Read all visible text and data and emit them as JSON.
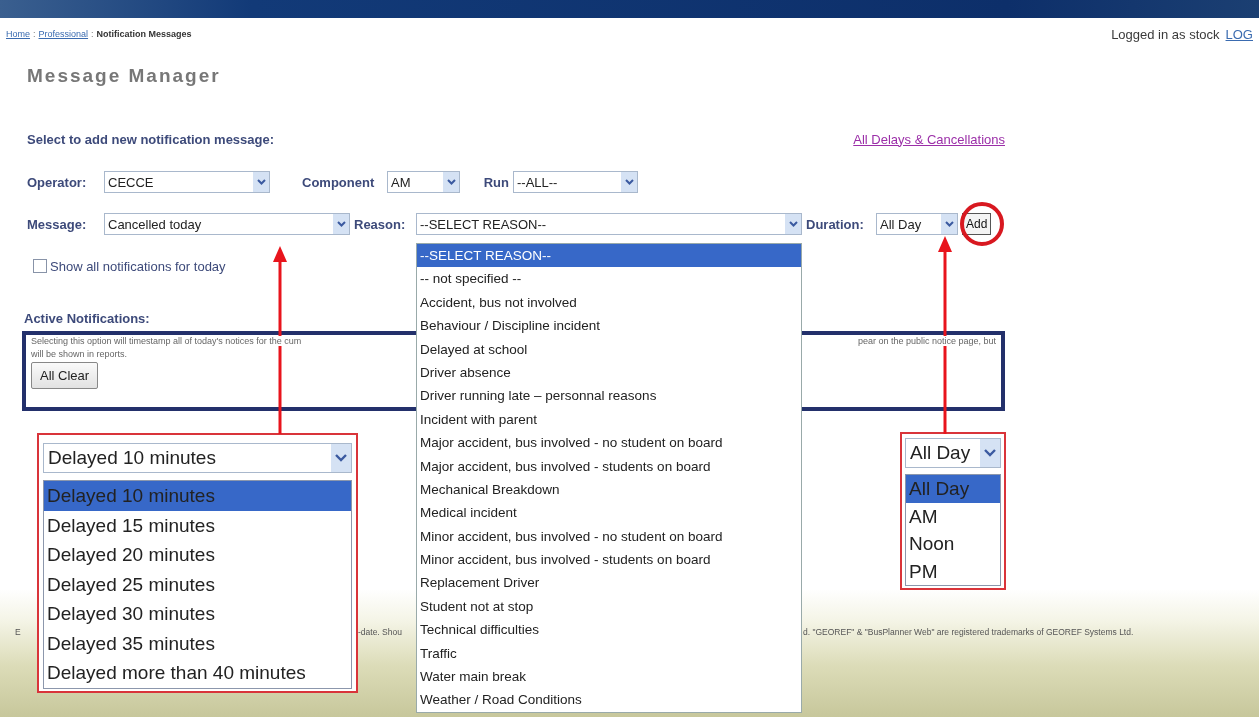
{
  "header": {
    "breadcrumb": [
      {
        "label": "Home",
        "link": true
      },
      {
        "label": "Professional",
        "link": true
      },
      {
        "label": "Notification Messages",
        "link": false
      }
    ],
    "separator": ":",
    "login_text": "Logged in as stock",
    "logout_link": "LOG"
  },
  "title": "Message Manager",
  "form": {
    "heading": "Select to add new notification message:",
    "all_link": "All Delays & Cancellations",
    "operator": {
      "label": "Operator:",
      "value": "CECCE"
    },
    "component": {
      "label": "Component",
      "value": "AM"
    },
    "run": {
      "label": "Run",
      "value": "--ALL--"
    },
    "message": {
      "label": "Message:",
      "value": "Cancelled today"
    },
    "reason": {
      "label": "Reason:",
      "value": "--SELECT REASON--"
    },
    "duration": {
      "label": "Duration:",
      "value": "All Day"
    },
    "add_button": "Add",
    "show_all": {
      "label": "Show all notifications for today",
      "checked": false
    }
  },
  "active_notifications": {
    "heading": "Active Notifications:",
    "notice_left": "Selecting this option will timestamp all of today's notices for the cum",
    "notice_right": "pear on the public notice page, but",
    "notice_line2": "will be shown in reports.",
    "button": "All Clear"
  },
  "footer": {
    "fragments": [
      "E",
      "-date. Shou",
      "d. \"GEOREF\" & \"BusPlanner Web\" are registered trademarks of GEOREF Systems Ltd."
    ]
  },
  "reason_list": [
    {
      "label": "--SELECT REASON--",
      "selected": true
    },
    {
      "label": "-- not specified --",
      "selected": false
    },
    {
      "label": "Accident, bus not involved",
      "selected": false
    },
    {
      "label": "Behaviour / Discipline incident",
      "selected": false
    },
    {
      "label": "Delayed at school",
      "selected": false
    },
    {
      "label": "Driver absence",
      "selected": false
    },
    {
      "label": "Driver running late – personnal reasons",
      "selected": false
    },
    {
      "label": "Incident with parent",
      "selected": false
    },
    {
      "label": "Major accident, bus involved - no student on board",
      "selected": false
    },
    {
      "label": "Major accident, bus involved - students on board",
      "selected": false
    },
    {
      "label": "Mechanical Breakdown",
      "selected": false
    },
    {
      "label": "Medical incident",
      "selected": false
    },
    {
      "label": "Minor accident, bus involved - no student on board",
      "selected": false
    },
    {
      "label": "Minor accident, bus involved - students on board",
      "selected": false
    },
    {
      "label": "Replacement Driver",
      "selected": false
    },
    {
      "label": "Student not at stop",
      "selected": false
    },
    {
      "label": "Technical difficulties",
      "selected": false
    },
    {
      "label": "Traffic",
      "selected": false
    },
    {
      "label": "Water main break",
      "selected": false
    },
    {
      "label": "Weather / Road Conditions",
      "selected": false
    }
  ],
  "message_callout": {
    "value": "Delayed 10 minutes",
    "options": [
      {
        "label": "Delayed 10 minutes",
        "selected": true
      },
      {
        "label": "Delayed 15 minutes",
        "selected": false
      },
      {
        "label": "Delayed 20 minutes",
        "selected": false
      },
      {
        "label": "Delayed 25 minutes",
        "selected": false
      },
      {
        "label": "Delayed 30 minutes",
        "selected": false
      },
      {
        "label": "Delayed 35 minutes",
        "selected": false
      },
      {
        "label": "Delayed more than 40 minutes",
        "selected": false
      }
    ]
  },
  "duration_callout": {
    "value": "All Day",
    "options": [
      {
        "label": "All Day",
        "selected": true
      },
      {
        "label": "AM",
        "selected": false
      },
      {
        "label": "Noon",
        "selected": false
      },
      {
        "label": "PM",
        "selected": false
      }
    ]
  }
}
